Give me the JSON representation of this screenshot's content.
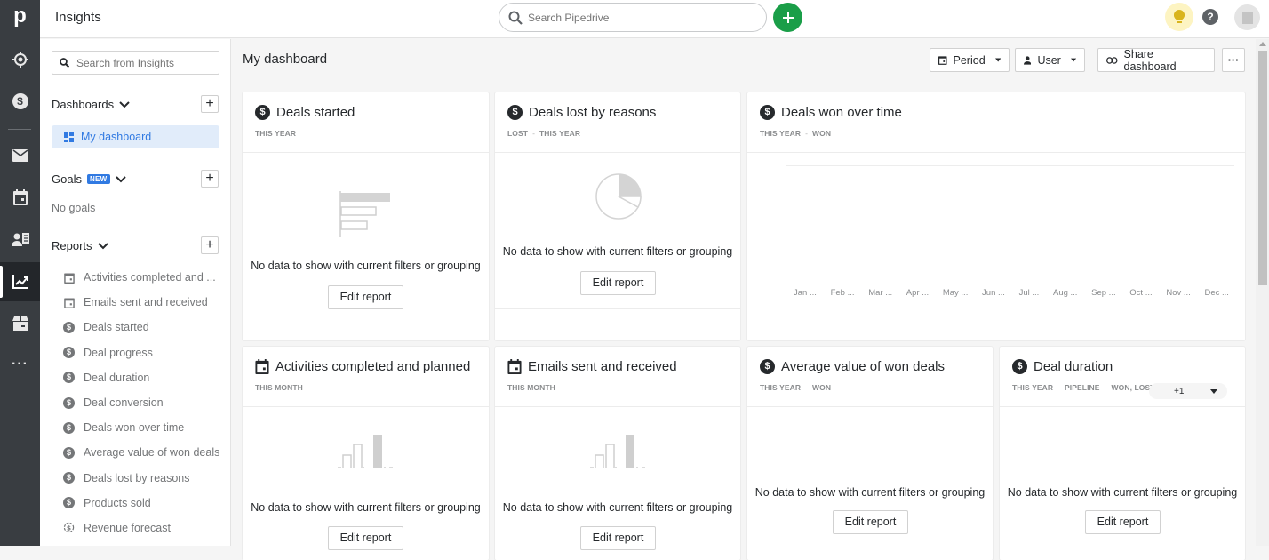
{
  "app": {
    "logo": "p",
    "title": "Insights"
  },
  "topbar": {
    "search_placeholder": "Search Pipedrive"
  },
  "rail": {
    "items": [
      "target-icon",
      "deals-icon",
      "mail-icon",
      "calendar-icon",
      "contacts-icon",
      "insights-icon",
      "products-icon",
      "more-icon"
    ],
    "active": "insights-icon"
  },
  "sidebar": {
    "search_placeholder": "Search from Insights",
    "dashboards_label": "Dashboards",
    "dashboards": [
      {
        "label": "My dashboard",
        "selected": true
      }
    ],
    "goals_label": "Goals",
    "goals_badge": "NEW",
    "goals_empty": "No goals",
    "reports_label": "Reports",
    "reports": [
      {
        "label": "Activities completed and ...",
        "icon": "calendar-icon"
      },
      {
        "label": "Emails sent and received",
        "icon": "calendar-icon"
      },
      {
        "label": "Deals started",
        "icon": "dollar-icon"
      },
      {
        "label": "Deal progress",
        "icon": "dollar-icon"
      },
      {
        "label": "Deal duration",
        "icon": "dollar-icon"
      },
      {
        "label": "Deal conversion",
        "icon": "dollar-icon"
      },
      {
        "label": "Deals won over time",
        "icon": "dollar-icon"
      },
      {
        "label": "Average value of won deals",
        "icon": "dollar-icon"
      },
      {
        "label": "Deals lost by reasons",
        "icon": "dollar-icon"
      },
      {
        "label": "Products sold",
        "icon": "dollar-icon"
      },
      {
        "label": "Revenue forecast",
        "icon": "forecast-icon"
      }
    ]
  },
  "main": {
    "title": "My dashboard",
    "toolbar": {
      "period_label": "Period",
      "user_label": "User",
      "share_label": "Share dashboard",
      "more_label": "···"
    },
    "no_data_text": "No data to show with current filters or grouping",
    "edit_label": "Edit report",
    "cards": [
      {
        "title": "Deals started",
        "icon": "dollar-icon",
        "filters": [
          "THIS YEAR"
        ],
        "placeholder": "horizontal-bar-placeholder"
      },
      {
        "title": "Deals lost by reasons",
        "icon": "dollar-icon",
        "filters": [
          "LOST",
          "THIS YEAR"
        ],
        "placeholder": "pie-placeholder"
      },
      {
        "title": "Deals won over time",
        "icon": "dollar-icon",
        "filters": [
          "THIS YEAR",
          "WON"
        ],
        "months": [
          "Jan ...",
          "Feb ...",
          "Mar ...",
          "Apr ...",
          "May ...",
          "Jun ...",
          "Jul ...",
          "Aug ...",
          "Sep ...",
          "Oct ...",
          "Nov ...",
          "Dec ..."
        ]
      },
      {
        "title": "Activities completed and planned",
        "icon": "calendar-icon",
        "filters": [
          "THIS MONTH"
        ],
        "placeholder": "column-placeholder"
      },
      {
        "title": "Emails sent and received",
        "icon": "calendar-icon",
        "filters": [
          "THIS MONTH"
        ],
        "placeholder": "column-placeholder"
      },
      {
        "title": "Average value of won deals",
        "icon": "dollar-icon",
        "filters": [
          "THIS YEAR",
          "WON"
        ]
      },
      {
        "title": "Deal duration",
        "icon": "dollar-icon",
        "filters": [
          "THIS YEAR",
          "PIPELINE",
          "WON, LOST"
        ],
        "extra_filters": "+1"
      }
    ]
  }
}
